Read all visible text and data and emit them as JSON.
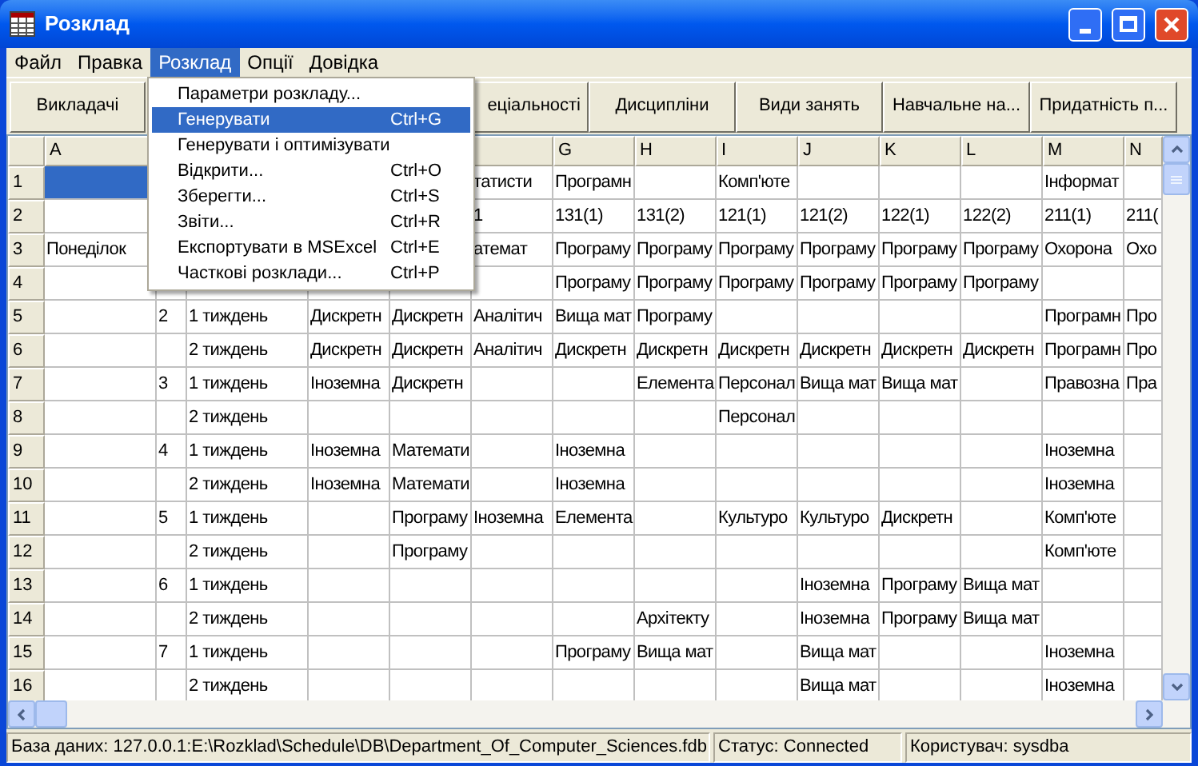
{
  "window": {
    "title": "Розклад"
  },
  "menubar": [
    {
      "label": "Файл",
      "selected": false
    },
    {
      "label": "Правка",
      "selected": false
    },
    {
      "label": "Розклад",
      "selected": true
    },
    {
      "label": "Опції",
      "selected": false
    },
    {
      "label": "Довідка",
      "selected": false
    }
  ],
  "menu": {
    "items": [
      {
        "label": "Параметри розкладу...",
        "selected": false
      },
      {
        "label": "Генерувати",
        "shortcut": "Ctrl+G",
        "selected": true
      },
      {
        "label": "Генерувати і оптимізувати",
        "selected": false
      },
      {
        "label": "Відкрити...",
        "shortcut": "Ctrl+O",
        "selected": false
      },
      {
        "label": "Зберегти...",
        "shortcut": "Ctrl+S",
        "selected": false
      },
      {
        "label": "Звіти...",
        "shortcut": "Ctrl+R",
        "selected": false
      },
      {
        "label": "Експортувати в MSExcel",
        "shortcut": "Ctrl+E",
        "selected": false
      },
      {
        "label": "Часткові розклади...",
        "shortcut": "Ctrl+P",
        "selected": false
      }
    ]
  },
  "toolbar": {
    "left_button": "Викладачі",
    "buttons": [
      "еціальності",
      "Дисципліни",
      "Види занять",
      "Навчальне на...",
      "Придатність п..."
    ]
  },
  "grid": {
    "columns": [
      {
        "label": "A"
      },
      {},
      {},
      {},
      {},
      {},
      {
        "label": "G"
      },
      {
        "label": "H"
      },
      {
        "label": "I"
      },
      {
        "label": "J"
      },
      {
        "label": "K"
      },
      {
        "label": "L"
      },
      {
        "label": "M"
      },
      {
        "label": "N"
      }
    ],
    "rows": [
      {
        "label": "1",
        "selected": true,
        "cells": [
          null,
          null,
          null,
          null,
          null,
          "татисти",
          "Програмн",
          null,
          "Комп'юте",
          null,
          null,
          null,
          "Інформат",
          null
        ]
      },
      {
        "label": "2",
        "cells": [
          null,
          null,
          null,
          null,
          null,
          "1",
          "131(1)",
          "131(2)",
          "121(1)",
          "121(2)",
          "122(1)",
          "122(2)",
          "211(1)",
          "211("
        ]
      },
      {
        "label": "3",
        "cells": [
          "Понеділок",
          null,
          null,
          null,
          null,
          "атемат",
          "Програму",
          "Програму",
          "Програму",
          "Програму",
          "Програму",
          "Програму",
          "Охорона",
          "Охо"
        ]
      },
      {
        "label": "4",
        "cells": [
          null,
          null,
          null,
          null,
          null,
          null,
          "Програму",
          "Програму",
          "Програму",
          "Програму",
          "Програму",
          "Програму",
          null,
          null
        ]
      },
      {
        "label": "5",
        "cells": [
          null,
          "2",
          "1 тиждень",
          "Дискретн",
          "Дискретн",
          "Аналітич",
          "Вища мат",
          "Програму",
          null,
          null,
          null,
          null,
          "Програмн",
          "Про"
        ]
      },
      {
        "label": "6",
        "cells": [
          null,
          null,
          "2 тиждень",
          "Дискретн",
          "Дискретн",
          "Аналітич",
          "Дискретн",
          "Дискретн",
          "Дискретн",
          "Дискретн",
          "Дискретн",
          "Дискретн",
          "Програмн",
          "Про"
        ]
      },
      {
        "label": "7",
        "cells": [
          null,
          "3",
          "1 тиждень",
          "Іноземна",
          "Дискретн",
          null,
          null,
          "Елемента",
          "Персонал",
          "Вища мат",
          "Вища мат",
          null,
          "Правозна",
          "Пра"
        ]
      },
      {
        "label": "8",
        "cells": [
          null,
          null,
          "2 тиждень",
          null,
          null,
          null,
          null,
          null,
          "Персонал",
          null,
          null,
          null,
          null,
          null
        ]
      },
      {
        "label": "9",
        "cells": [
          null,
          "4",
          "1 тиждень",
          "Іноземна",
          "Математи",
          null,
          "Іноземна",
          null,
          null,
          null,
          null,
          null,
          "Іноземна",
          null
        ]
      },
      {
        "label": "10",
        "cells": [
          null,
          null,
          "2 тиждень",
          "Іноземна",
          "Математи",
          null,
          "Іноземна",
          null,
          null,
          null,
          null,
          null,
          "Іноземна",
          null
        ]
      },
      {
        "label": "11",
        "cells": [
          null,
          "5",
          "1 тиждень",
          null,
          "Програму",
          "Іноземна",
          "Елемента",
          null,
          "Культуро",
          "Культуро",
          "Дискретн",
          null,
          "Комп'юте",
          null
        ]
      },
      {
        "label": "12",
        "cells": [
          null,
          null,
          "2 тиждень",
          null,
          "Програму",
          null,
          null,
          null,
          null,
          null,
          null,
          null,
          "Комп'юте",
          null
        ]
      },
      {
        "label": "13",
        "cells": [
          null,
          "6",
          "1 тиждень",
          null,
          null,
          null,
          null,
          null,
          null,
          "Іноземна",
          "Програму",
          "Вища мат",
          null,
          null
        ]
      },
      {
        "label": "14",
        "cells": [
          null,
          null,
          "2 тиждень",
          null,
          null,
          null,
          null,
          "Архітекту",
          null,
          "Іноземна",
          "Програму",
          "Вища мат",
          null,
          null
        ]
      },
      {
        "label": "15",
        "cells": [
          null,
          "7",
          "1 тиждень",
          null,
          null,
          null,
          "Програму",
          "Вища мат",
          null,
          "Вища мат",
          null,
          null,
          "Іноземна",
          null
        ]
      },
      {
        "label": "16",
        "cells": [
          null,
          null,
          "2 тиждень",
          null,
          null,
          null,
          null,
          null,
          null,
          "Вища мат",
          null,
          null,
          "Іноземна",
          null
        ]
      }
    ]
  },
  "status_bar": [
    "База даних: 127.0.0.1:E:\\Rozklad\\Schedule\\DB\\Department_Of_Computer_Sciences.fdb",
    "Статус: Connected",
    "Користувач: sysdba"
  ]
}
